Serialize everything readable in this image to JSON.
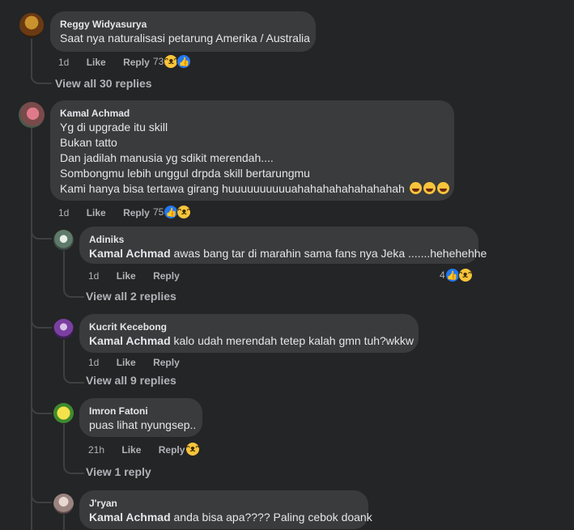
{
  "top_comment": {
    "author": "Reggy Widyasurya",
    "text": "Saat nya naturalisasi petarung Amerika / Australia",
    "time": "1d",
    "like_label": "Like",
    "reply_label": "Reply",
    "reaction_count": "73",
    "view_replies": "View all 30 replies"
  },
  "main_comment": {
    "author": "Kamal Achmad",
    "lines": [
      "Yg di upgrade itu skill",
      "Bukan tatto",
      "Dan jadilah manusia yg sdikit merendah....",
      "Sombongmu lebih unggul drpda skill bertarungmu",
      "Kami hanya bisa tertawa girang huuuuuuuuuuahahahahahahahahah"
    ],
    "time": "1d",
    "like_label": "Like",
    "reply_label": "Reply",
    "reaction_count": "75"
  },
  "replies": [
    {
      "author": "Adiniks",
      "mention": "Kamal Achmad",
      "text": "awas bang tar di marahin sama fans nya Jeka .......hehehehhe",
      "time": "1d",
      "like_label": "Like",
      "reply_label": "Reply",
      "reaction_count": "4",
      "view_replies": "View all 2 replies"
    },
    {
      "author": "Kucrit Kecebong",
      "mention": "Kamal Achmad",
      "text": "kalo udah merendah tetep kalah gmn tuh?wkkw",
      "time": "1d",
      "like_label": "Like",
      "reply_label": "Reply",
      "view_replies": "View all 9 replies"
    },
    {
      "author": "Imron Fatoni",
      "text": "puas lihat nyungsep..",
      "time": "21h",
      "like_label": "Like",
      "reply_label": "Reply",
      "view_replies": "View 1 reply"
    },
    {
      "author": "J'ryan",
      "mention": "Kamal Achmad",
      "text": "anda bisa apa???? Paling cebok doank"
    }
  ],
  "colors": {
    "background": "#242526",
    "bubble": "#3a3b3c",
    "text": "#e4e6eb",
    "secondary": "#b0b3b8",
    "like_blue": "#2078f4",
    "haha_yellow": "#f7c43b"
  }
}
